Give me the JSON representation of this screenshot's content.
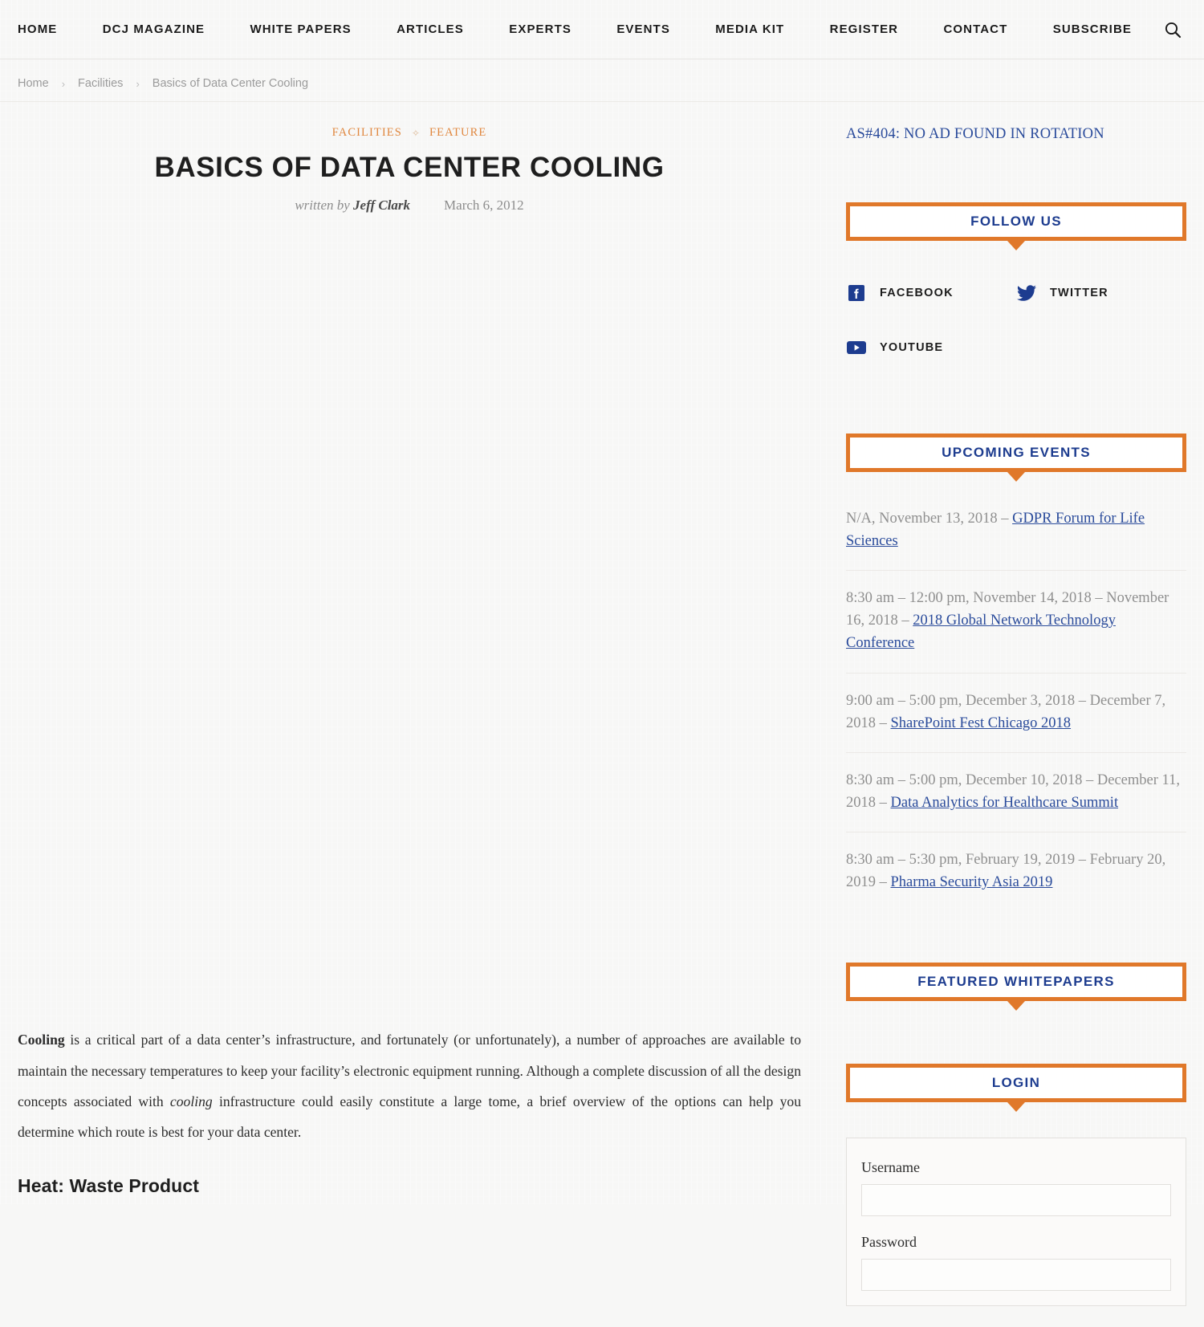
{
  "nav": {
    "items": [
      {
        "label": "HOME",
        "name": "nav-home"
      },
      {
        "label": "DCJ MAGAZINE",
        "name": "nav-dcj-magazine"
      },
      {
        "label": "WHITE PAPERS",
        "name": "nav-white-papers"
      },
      {
        "label": "ARTICLES",
        "name": "nav-articles"
      },
      {
        "label": "EXPERTS",
        "name": "nav-experts"
      },
      {
        "label": "EVENTS",
        "name": "nav-events"
      },
      {
        "label": "MEDIA KIT",
        "name": "nav-media-kit"
      },
      {
        "label": "REGISTER",
        "name": "nav-register"
      },
      {
        "label": "CONTACT",
        "name": "nav-contact"
      },
      {
        "label": "SUBSCRIBE",
        "name": "nav-subscribe"
      }
    ],
    "search_icon": "search-icon"
  },
  "breadcrumb": {
    "home": "Home",
    "section": "Facilities",
    "current": "Basics of Data Center Cooling",
    "separator": "›"
  },
  "article": {
    "categories": [
      "FACILITIES",
      "FEATURE"
    ],
    "category_separator": "✧",
    "title": "BASICS OF DATA CENTER COOLING",
    "written_by_label": "written by",
    "author": "Jeff Clark",
    "date": "March 6, 2012",
    "paragraph_lead": "Cooling",
    "paragraph_part1": " is a critical part of a data center’s infrastructure, and fortunately (or unfortunately), a number of approaches are available to maintain the necessary temperatures to keep your facility’s electronic equipment running. Although a complete discussion of all the design concepts associated with ",
    "paragraph_emphasis": "cooling",
    "paragraph_part2": " infrastructure could easily constitute a large tome, a brief overview of the options can help you determine which route is best for your data center.",
    "subheading": "Heat: Waste Product"
  },
  "sidebar": {
    "ad_notice": "AS#404: NO AD FOUND IN ROTATION",
    "follow_us": {
      "title": "FOLLOW US",
      "links": [
        {
          "label": "FACEBOOK",
          "icon": "facebook-icon"
        },
        {
          "label": "TWITTER",
          "icon": "twitter-icon"
        },
        {
          "label": "YOUTUBE",
          "icon": "youtube-icon"
        }
      ]
    },
    "upcoming_events": {
      "title": "UPCOMING EVENTS",
      "items": [
        {
          "when": "N/A, November 13, 2018 – ",
          "link": "GDPR Forum for Life Sciences"
        },
        {
          "when": "8:30 am – 12:00 pm, November 14, 2018 – November 16, 2018 – ",
          "link": "2018 Global Network Technology Conference"
        },
        {
          "when": "9:00 am – 5:00 pm, December 3, 2018 – December 7, 2018 – ",
          "link": "SharePoint Fest Chicago 2018"
        },
        {
          "when": "8:30 am – 5:00 pm, December 10, 2018 – December 11, 2018 – ",
          "link": "Data Analytics for Healthcare Summit"
        },
        {
          "when": "8:30 am – 5:30 pm, February 19, 2019 – February 20, 2019 – ",
          "link": "Pharma Security Asia 2019"
        }
      ]
    },
    "featured_whitepapers": {
      "title": "FEATURED WHITEPAPERS"
    },
    "login": {
      "title": "LOGIN",
      "username_label": "Username",
      "username_value": "",
      "password_label": "Password",
      "password_value": ""
    }
  },
  "colors": {
    "accent_orange": "#e0782a",
    "link_navy": "#2a4b9b",
    "heading_navy": "#1d3c8f",
    "category_orange": "#e0873f",
    "page_bg": "#f7f7f6"
  }
}
